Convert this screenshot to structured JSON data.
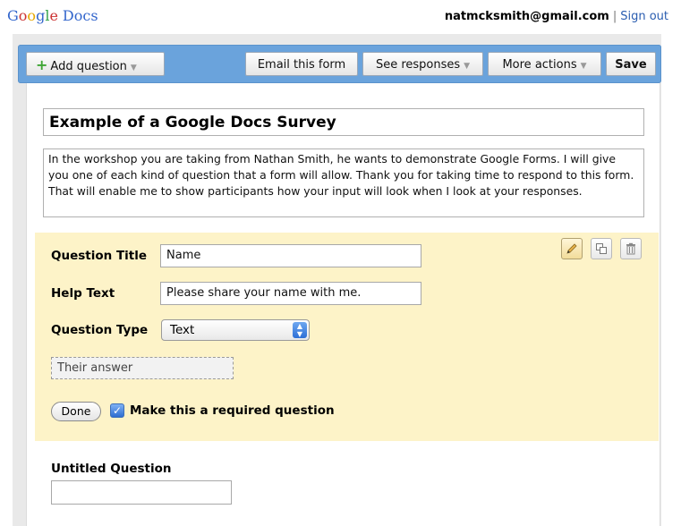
{
  "header": {
    "logo_letters": [
      "G",
      "o",
      "o",
      "g",
      "l",
      "e"
    ],
    "logo_product": "Docs",
    "email": "natmcksmith@gmail.com",
    "separator": "|",
    "sign_out": "Sign out"
  },
  "toolbar": {
    "add_question": "Add question",
    "email_form": "Email this form",
    "see_responses": "See responses",
    "more_actions": "More actions",
    "save": "Save",
    "caret": "▼"
  },
  "form": {
    "title": "Example of a Google Docs Survey",
    "description": "In the workshop you are taking from Nathan Smith, he wants to demonstrate Google Forms.  I will give you one of each kind of question that a form will allow.  Thank you for taking time to respond to this form.  That will enable me to show participants how your input will look when I look at your responses."
  },
  "question_editor": {
    "title_label": "Question Title",
    "title_value": "Name",
    "help_label": "Help Text",
    "help_value": "Please share your name with me.",
    "type_label": "Question Type",
    "type_value": "Text",
    "preview_placeholder": "Their answer",
    "done": "Done",
    "required_label": "Make this a required question",
    "required_checked": true,
    "icons": [
      "pencil-icon",
      "duplicate-icon",
      "trash-icon"
    ]
  },
  "next_question": {
    "title": "Untitled Question"
  },
  "colors": {
    "toolbar": "#6aa3dc",
    "edit_highlight": "#fdf3c8",
    "link": "#2a5db0"
  }
}
